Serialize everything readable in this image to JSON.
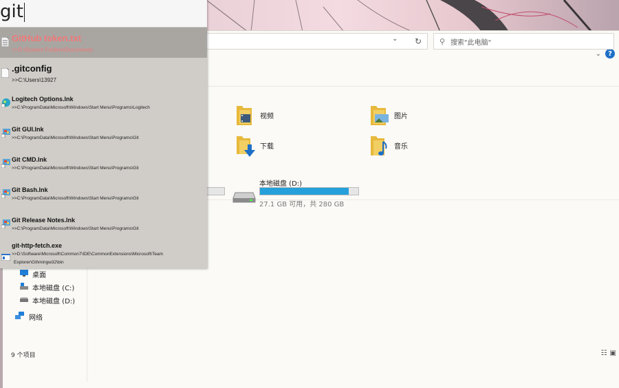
{
  "launcher": {
    "query": "git",
    "results": [
      {
        "title": "GitHub token.txt",
        "path": ">>D:\\System Folders\\Documents",
        "icon": "text-file-icon",
        "selected": true
      },
      {
        "title": ".gitconfig",
        "path": ">>C:\\Users\\13927",
        "icon": "blank-file-icon"
      },
      {
        "title": "Logitech Options.lnk",
        "path": ">>C:\\ProgramData\\Microsoft\\Windows\\Start Menu\\Programs\\Logitech",
        "icon": "logitech-shortcut-icon"
      },
      {
        "title": "Git GUI.lnk",
        "path": ">>C:\\ProgramData\\Microsoft\\Windows\\Start Menu\\Programs\\Git",
        "icon": "git-shortcut-icon"
      },
      {
        "title": "Git CMD.lnk",
        "path": ">>C:\\ProgramData\\Microsoft\\Windows\\Start Menu\\Programs\\Git",
        "icon": "git-shortcut-icon"
      },
      {
        "title": "Git Bash.lnk",
        "path": ">>C:\\ProgramData\\Microsoft\\Windows\\Start Menu\\Programs\\Git",
        "icon": "git-shortcut-icon"
      },
      {
        "title": "Git Release Notes.lnk",
        "path": ">>C:\\ProgramData\\Microsoft\\Windows\\Start Menu\\Programs\\Git",
        "icon": "git-shortcut-icon"
      },
      {
        "title": "git-http-fetch.exe",
        "path": ">>D:\\Software\\Microsoft\\Common7\\IDE\\CommonExtensions\\Microsoft\\Team",
        "path2": "Explorer\\Git\\mingw32\\bin",
        "icon": "exe-icon"
      }
    ]
  },
  "explorer": {
    "window_controls": {
      "minimize": "—",
      "maximize": "☐",
      "close": "✕"
    },
    "search_placeholder": "搜索\"此电脑\"",
    "folders": [
      {
        "label": "视频",
        "icon": "videos-folder-icon"
      },
      {
        "label": "图片",
        "icon": "pictures-folder-icon"
      },
      {
        "label": "下载",
        "icon": "downloads-folder-icon"
      },
      {
        "label": "音乐",
        "icon": "music-folder-icon"
      }
    ],
    "drive_d": {
      "name": "本地磁盘 (D:)",
      "free_text": "27.1 GB 可用，共 280 GB",
      "used_fraction": 0.903
    },
    "nav": [
      {
        "label": "桌面",
        "icon": "desktop-icon"
      },
      {
        "label": "本地磁盘 (C:)",
        "icon": "drive-c-icon"
      },
      {
        "label": "本地磁盘 (D:)",
        "icon": "drive-d-icon"
      },
      {
        "label": "网络",
        "icon": "network-icon"
      }
    ],
    "status": "9 个项目",
    "colors": {
      "accent": "#26a0da",
      "selected_text": "#f07878"
    }
  }
}
